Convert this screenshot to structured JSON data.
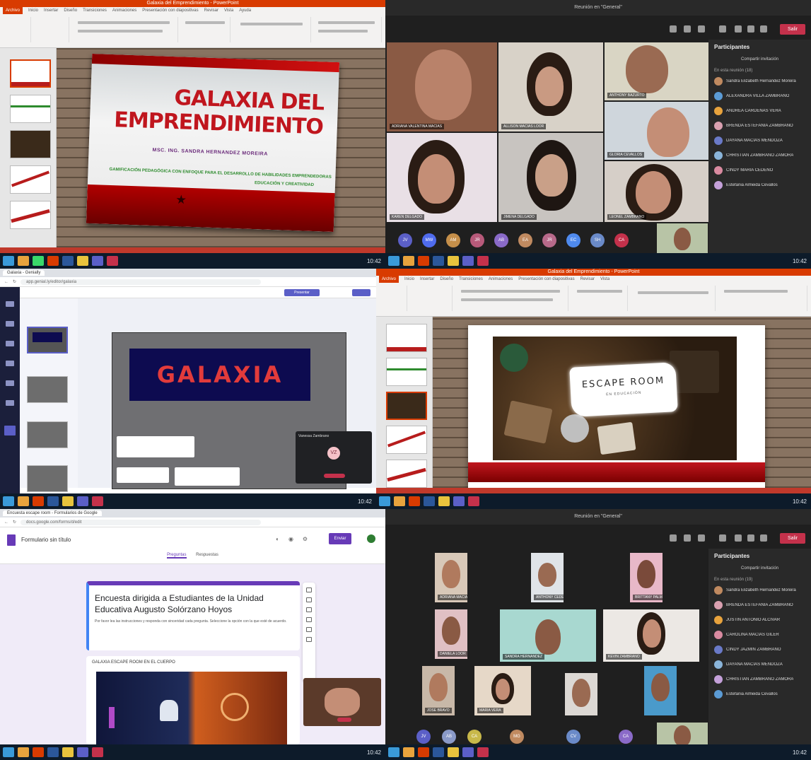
{
  "ppt": {
    "window_title": "Galaxia del Emprendimiento - PowerPoint",
    "tabs": [
      "Archivo",
      "Inicio",
      "Insertar",
      "Diseño",
      "Transiciones",
      "Animaciones",
      "Presentación con diapositivas",
      "Revisar",
      "Vista",
      "Ayuda"
    ],
    "slide1": {
      "title_line1": "GALAXIA DEL",
      "title_line2": "EMPRENDIMIENTO",
      "author": "MSC. ING. SANDRA HERNANDEZ MOREIRA",
      "subtitle": "GAMIFICACIÓN PEDAGÓGICA CON ENFOQUE PARA EL DESARROLLO DE HABILIDADES EMPRENDEDORAS",
      "tagline": "EDUCACIÓN Y CREATIVIDAD"
    },
    "slide2": {
      "title": "ESCAPE ROOM",
      "subtitle": "EN EDUCACIÓN"
    },
    "colors": {
      "brand": "#d83b01",
      "slide_red": "#c0161e"
    }
  },
  "teams1": {
    "window_title": "Reunión en \"General\"",
    "leave_label": "Salir",
    "panel_title": "Participantes",
    "invite_label": "Compartir invitación",
    "in_meeting_label": "En esta reunión (18)",
    "participants": [
      "Sandra Elizabeth Hernandez Moreira",
      "ALEXANDRA VILLA ZAMBRANO",
      "ANDREA CARDENAS VERA",
      "BRENDA ESTEFANIA ZAMBRANO",
      "DAYANA MACIAS MENDOZA",
      "CHRISTIAN ZAMBRANO ZAMORA",
      "CINDY MARIA CEDEÑO",
      "Estefania Almeida Cevallos"
    ],
    "tiles": [
      "ADRIANA VALENTINA MACIAS",
      "ALLISON MACIAS LOOR",
      "ANTHONY BAZURTO",
      "GLORIA CEVALLOS",
      "KAREN DELGADO",
      "JIMENA DELGADO",
      "LEONEL ZAMBRANO",
      "MARIA JOSE ALCIVAR"
    ],
    "bubbles": [
      "JV",
      "MW",
      "AM",
      "JR",
      "AB",
      "EA",
      "JR",
      "EC",
      "SH",
      "CA"
    ]
  },
  "genially": {
    "tab_label": "Galaxia - Genially",
    "url": "app.genial.ly/editor/galaxia",
    "banner_text": "GALAXIA",
    "present_label": "Presentar",
    "call_name": "Vanessa Zambrano",
    "call_initials": "VZ"
  },
  "forms": {
    "tab_label": "Encuesta escape room - Formularios de Google",
    "url": "docs.google.com/forms/d/edit",
    "title": "Formulario sin título",
    "send_label": "Enviar",
    "tab_questions": "Preguntas",
    "tab_responses": "Respuestas",
    "heading": "Encuesta dirigida a Estudiantes de la Unidad Educativa Augusto Solórzano Hoyos",
    "description": "Por favor lea las instrucciones y responda con sinceridad cada pregunta. Seleccione la opción con la que esté de acuerdo.",
    "section_label": "GALAXIA ESCAPE ROOM EN EL CUERPO"
  },
  "teams2": {
    "window_title": "Reunión en \"General\"",
    "leave_label": "Salir",
    "panel_title": "Participantes",
    "invite_label": "Compartir invitación",
    "in_meeting_label": "En esta reunión (19)",
    "participants": [
      "Sandra Elizabeth Hernandez Moreira",
      "BRENDA ESTEFANIA ZAMBRANO",
      "JUSTIN ANTONIO ALCIVAR",
      "CAROLINA MACIAS GILER",
      "CINDY JAZMIN ZAMBRANO",
      "DAYANA MACIAS MENDOZA",
      "CHRISTIAN ZAMBRANO ZAMORA",
      "Estefania Almeida Cevallos"
    ],
    "tiles": [
      "ADRIANA MACIAS",
      "ANTHONY CEDEÑO",
      "BRITTANY PALMA",
      "DANIELA LOOR",
      "SANDRA HERNANDEZ",
      "KEVIN ZAMBRANO",
      "JOSE BRAVO",
      "MARIA VERA"
    ],
    "bubbles": [
      "JV",
      "AB",
      "CA",
      "MG",
      "CV",
      "CA"
    ]
  },
  "taskbar": {
    "clock": "10:42"
  }
}
